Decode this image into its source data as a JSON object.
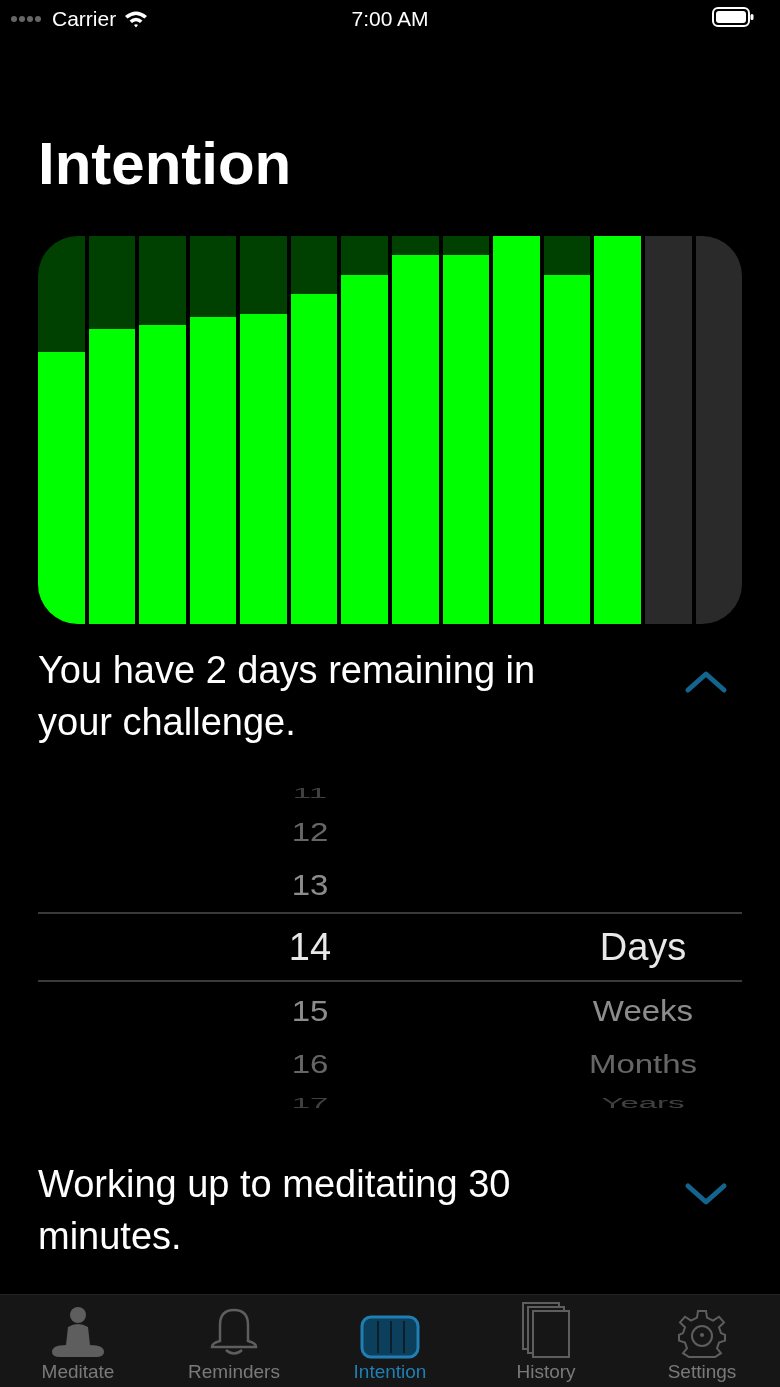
{
  "status_bar": {
    "carrier": "Carrier",
    "time": "7:00 AM"
  },
  "title": "Intention",
  "days": [
    {
      "kind": "completed",
      "level": 0.7
    },
    {
      "kind": "completed",
      "level": 0.76
    },
    {
      "kind": "completed",
      "level": 0.77
    },
    {
      "kind": "completed",
      "level": 0.79
    },
    {
      "kind": "completed",
      "level": 0.8
    },
    {
      "kind": "completed",
      "level": 0.85
    },
    {
      "kind": "completed",
      "level": 0.9
    },
    {
      "kind": "completed",
      "level": 0.95
    },
    {
      "kind": "completed",
      "level": 0.95
    },
    {
      "kind": "completed",
      "level": 1
    },
    {
      "kind": "completed",
      "level": 0.9
    },
    {
      "kind": "completed",
      "level": 1
    },
    {
      "kind": "remaining"
    },
    {
      "kind": "remaining"
    }
  ],
  "sections": [
    {
      "text": "You have 2 days remaining in your challenge.",
      "expanded": true,
      "picker": {
        "numbers": [
          {
            "text": "11",
            "selected": false
          },
          {
            "text": "12",
            "selected": false
          },
          {
            "text": "13",
            "selected": false
          },
          {
            "text": "14",
            "selected": true
          },
          {
            "text": "15",
            "selected": false
          },
          {
            "text": "16",
            "selected": false
          },
          {
            "text": "17",
            "selected": false
          }
        ],
        "units": [
          {
            "text": "Days",
            "selected": true
          },
          {
            "text": "Weeks",
            "selected": false
          },
          {
            "text": "Months",
            "selected": false
          },
          {
            "text": "Years",
            "selected": false
          }
        ]
      }
    },
    {
      "text": "Working up to meditating 30 minutes.",
      "expanded": false
    }
  ],
  "tabs": [
    {
      "label": "Meditate",
      "selected": false
    },
    {
      "label": "Reminders",
      "selected": false
    },
    {
      "label": "Intention",
      "selected": true
    },
    {
      "label": "History",
      "selected": false
    },
    {
      "label": "Settings",
      "selected": false
    }
  ]
}
